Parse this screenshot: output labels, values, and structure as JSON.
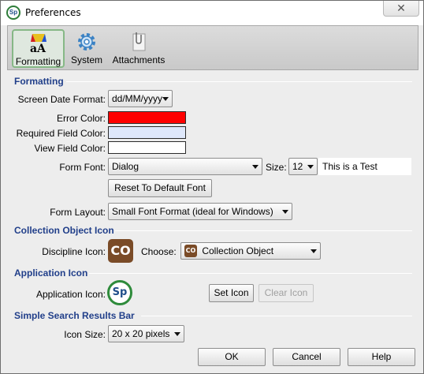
{
  "window": {
    "title": "Preferences",
    "close_glyph": "✕"
  },
  "toolbar": {
    "items": [
      {
        "label": "Formatting",
        "icon": "formatting-icon",
        "selected": true
      },
      {
        "label": "System",
        "icon": "gear-icon",
        "selected": false
      },
      {
        "label": "Attachments",
        "icon": "paperclip-icon",
        "selected": false
      }
    ]
  },
  "formatting": {
    "section_title": "Formatting",
    "date_format_label": "Screen Date Format:",
    "date_format_value": "dd/MM/yyyy",
    "error_color_label": "Error Color:",
    "error_color": "#ff0000",
    "required_color_label": "Required Field Color:",
    "required_color": "#dfe8fb",
    "view_color_label": "View Field Color:",
    "view_color": "#ffffff",
    "form_font_label": "Form Font:",
    "form_font_value": "Dialog",
    "size_label": "Size:",
    "size_value": "12",
    "test_text": "This is a Test",
    "reset_font_button": "Reset To Default Font",
    "form_layout_label": "Form Layout:",
    "form_layout_value": "Small Font Format (ideal for Windows)"
  },
  "collection_icon": {
    "section_title": "Collection Object Icon",
    "discipline_label": "Discipline Icon:",
    "discipline_icon_text": "CO",
    "choose_label": "Choose:",
    "choose_icon_text": "CO",
    "choose_value": "Collection Object"
  },
  "application_icon": {
    "section_title": "Application Icon",
    "app_icon_label": "Application Icon:",
    "app_icon_text": "Sp",
    "set_icon_button": "Set Icon",
    "clear_icon_button": "Clear Icon"
  },
  "search_bar": {
    "section_title": "Simple Search Results Bar",
    "icon_size_label": "Icon Size:",
    "icon_size_value": "20 x 20 pixels"
  },
  "footer": {
    "ok_button": "OK",
    "cancel_button": "Cancel",
    "help_button": "Help"
  },
  "colors": {
    "section_title": "#213f8a",
    "brand_green": "#2e8b3b",
    "co_brown": "#7a4b27"
  }
}
